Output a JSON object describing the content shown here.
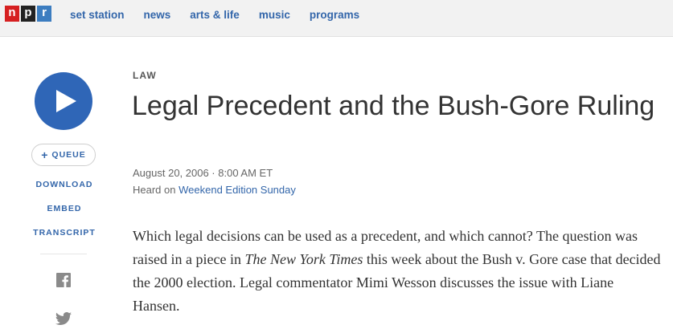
{
  "logo": {
    "letters": [
      "n",
      "p",
      "r"
    ]
  },
  "nav": {
    "items": [
      "set station",
      "news",
      "arts & life",
      "music",
      "programs"
    ]
  },
  "sidebar": {
    "queue_label": "QUEUE",
    "links": [
      "DOWNLOAD",
      "EMBED",
      "TRANSCRIPT"
    ],
    "icons": [
      "play-icon",
      "plus-icon",
      "facebook-icon",
      "twitter-icon"
    ]
  },
  "article": {
    "slug": "LAW",
    "title": "Legal Precedent and the Bush-Gore Ruling",
    "date": "August 20, 2006 · 8:00 AM ET",
    "heard_prefix": "Heard on",
    "heard_program": "Weekend Edition Sunday",
    "body": {
      "part1": "Which legal decisions can be used as a precedent, and which cannot? The question was raised in a piece in ",
      "publication": "The New York Times",
      "part2": " this week about the Bush v. Gore case that decided the 2000 election. Legal commentator Mimi Wesson discusses the issue with Liane Hansen."
    }
  },
  "colors": {
    "brand_blue": "#2f66b7",
    "link_blue": "#3366aa",
    "npr_red": "#d62021",
    "npr_black": "#222222",
    "npr_blue": "#3c7dc0"
  }
}
